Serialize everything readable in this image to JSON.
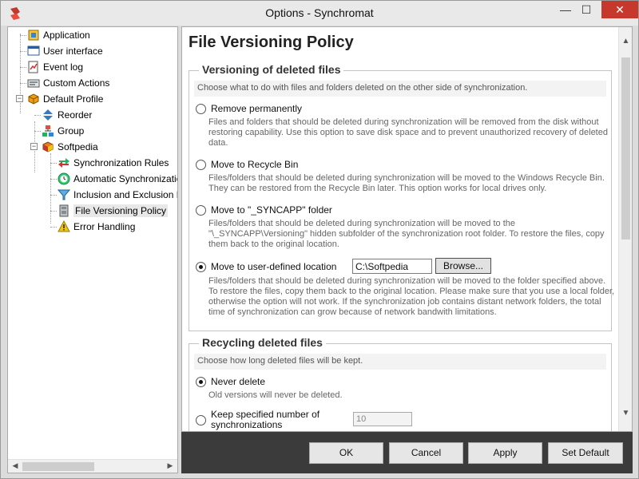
{
  "window": {
    "title": "Options - Synchromat",
    "minimize_glyph": "—",
    "maximize_glyph": "☐",
    "close_glyph": "✕"
  },
  "tree": {
    "items": [
      {
        "label": "Application",
        "icon": "application-icon"
      },
      {
        "label": "User interface",
        "icon": "user-interface-icon"
      },
      {
        "label": "Event log",
        "icon": "event-log-icon"
      },
      {
        "label": "Custom Actions",
        "icon": "custom-actions-icon"
      },
      {
        "label": "Default Profile",
        "icon": "profile-icon",
        "expander": "−"
      },
      {
        "label": "Reorder",
        "icon": "reorder-icon"
      },
      {
        "label": "Group",
        "icon": "group-icon"
      },
      {
        "label": "Softpedia",
        "icon": "profile-cube-icon",
        "expander": "−"
      },
      {
        "label": "Synchronization Rules",
        "icon": "sync-rules-icon"
      },
      {
        "label": "Automatic Synchronizatio",
        "icon": "auto-sync-icon"
      },
      {
        "label": "Inclusion and Exclusion F",
        "icon": "filter-icon"
      },
      {
        "label": "File Versioning Policy",
        "icon": "file-versioning-icon"
      },
      {
        "label": "Error Handling",
        "icon": "warning-icon"
      }
    ]
  },
  "content": {
    "title": "File Versioning Policy",
    "versioning": {
      "legend": "Versioning of deleted files",
      "description": "Choose what to do with files and folders deleted on the other side of synchronization.",
      "options": [
        {
          "label": "Remove permanently",
          "desc": "Files and folders that should be deleted during synchronization will be removed from the disk without restoring capability. Use this option to save disk space and to prevent unauthorized recovery of deleted data.",
          "checked": false
        },
        {
          "label": "Move to Recycle Bin",
          "desc": "Files/folders that should be deleted during synchronization will be moved to the Windows Recycle Bin. They can be restored from the Recycle Bin later. This option works for local drives only.",
          "checked": false
        },
        {
          "label": "Move to \"_SYNCAPP\" folder",
          "desc": "Files/folders that should be deleted during synchronization will be moved to the \"\\_SYNCAPP\\Versioning\" hidden subfolder of the synchronization root folder. To restore the files, copy them back to the original location.",
          "checked": false
        },
        {
          "label": "Move to user-defined location",
          "desc": "Files/folders that should be deleted during synchronization will be moved to the folder specified above. To restore the files, copy them back to the original location. Please make sure that you use a local folder, otherwise the option will not work. If the synchronization job contains distant network folders, the total time of synchronization can grow because of network bandwith limitations.",
          "checked": true
        }
      ],
      "path_value": "C:\\Softpedia",
      "browse_label": "Browse..."
    },
    "recycling": {
      "legend": "Recycling deleted files",
      "description": "Choose how long deleted files will be kept.",
      "options": [
        {
          "label": "Never delete",
          "desc": "Old versions will never be deleted.",
          "checked": true
        },
        {
          "label": "Keep specified number of synchronizations",
          "checked": false
        }
      ],
      "count_value": "10"
    }
  },
  "footer": {
    "ok": "OK",
    "cancel": "Cancel",
    "apply": "Apply",
    "set_default": "Set Default"
  },
  "scroll": {
    "up": "▲",
    "down": "▼",
    "left": "◀",
    "right": "▶"
  }
}
